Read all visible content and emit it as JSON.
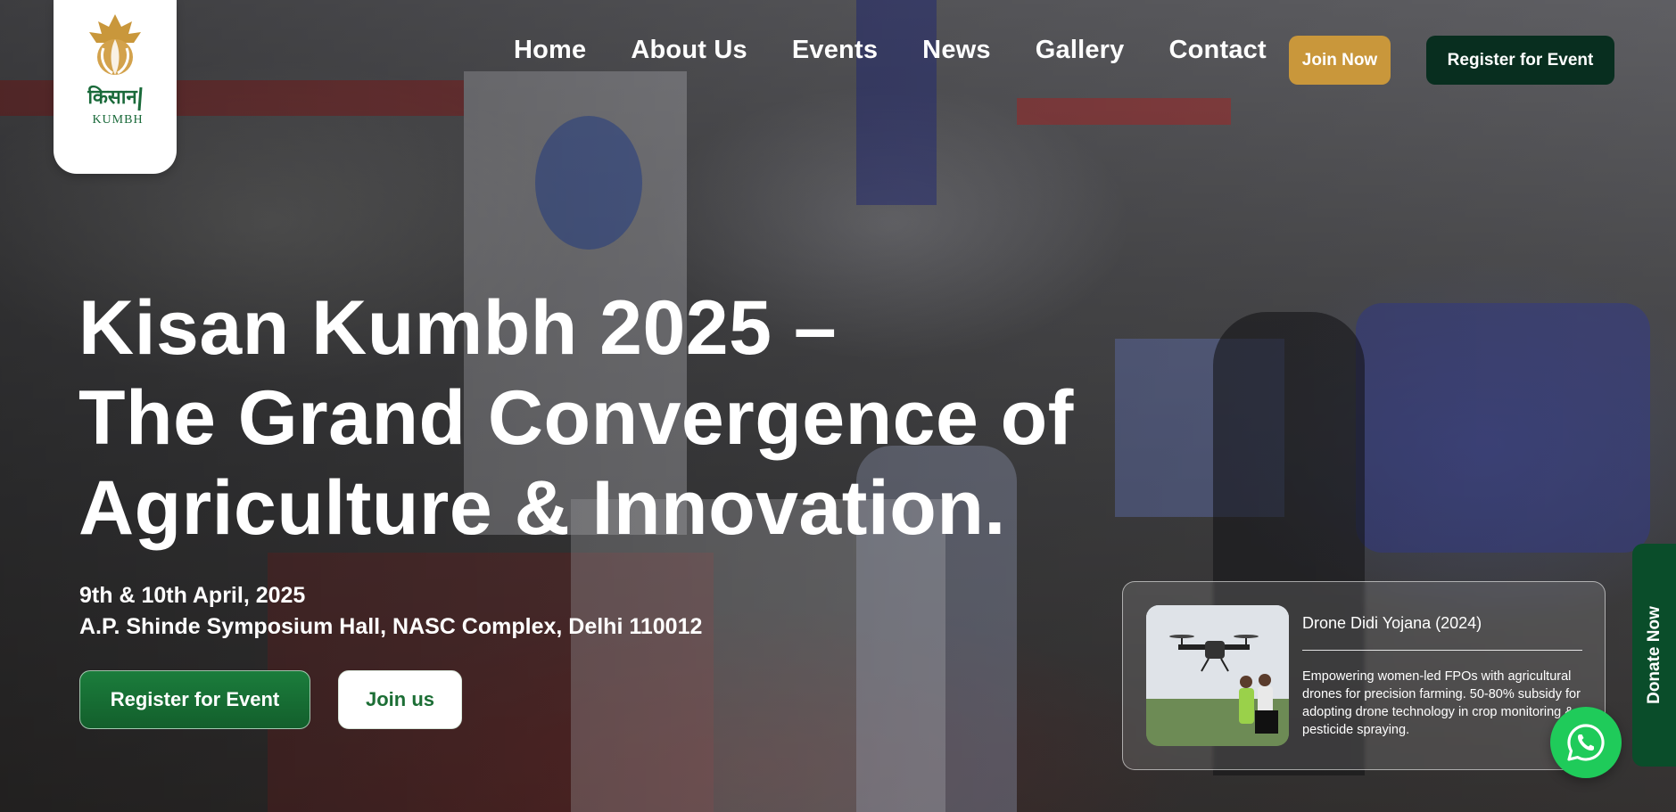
{
  "logo": {
    "alt": "Kisan Kumbh logo",
    "hindi_text": "किसान",
    "brand_text": "KUMBH"
  },
  "nav": {
    "items": [
      "Home",
      "About Us",
      "Events",
      "News",
      "Gallery",
      "Contact"
    ],
    "join_now": "Join Now",
    "register": "Register for Event"
  },
  "hero": {
    "headline_line1": "Kisan Kumbh 2025 –",
    "headline_line2": "The Grand Convergence of",
    "headline_line3": "Agriculture & Innovation.",
    "date": "9th & 10th April, 2025",
    "venue": "A.P. Shinde Symposium Hall, NASC Complex, Delhi 110012",
    "register_button": "Register for Event",
    "join_button": "Join us"
  },
  "scheme": {
    "title": "Drone Didi Yojana (2024)",
    "description": "Empowering women-led FPOs with agricultural drones for precision farming. 50-80% subsidy for adopting drone technology in crop monitoring & pesticide spraying."
  },
  "floating": {
    "whatsapp_icon": "whatsapp-icon",
    "donate": "Donate Now"
  },
  "colors": {
    "gold": "#c9973b",
    "dark_green": "#082e1f",
    "green": "#1b7d3c",
    "whatsapp": "#1fcb5a"
  }
}
